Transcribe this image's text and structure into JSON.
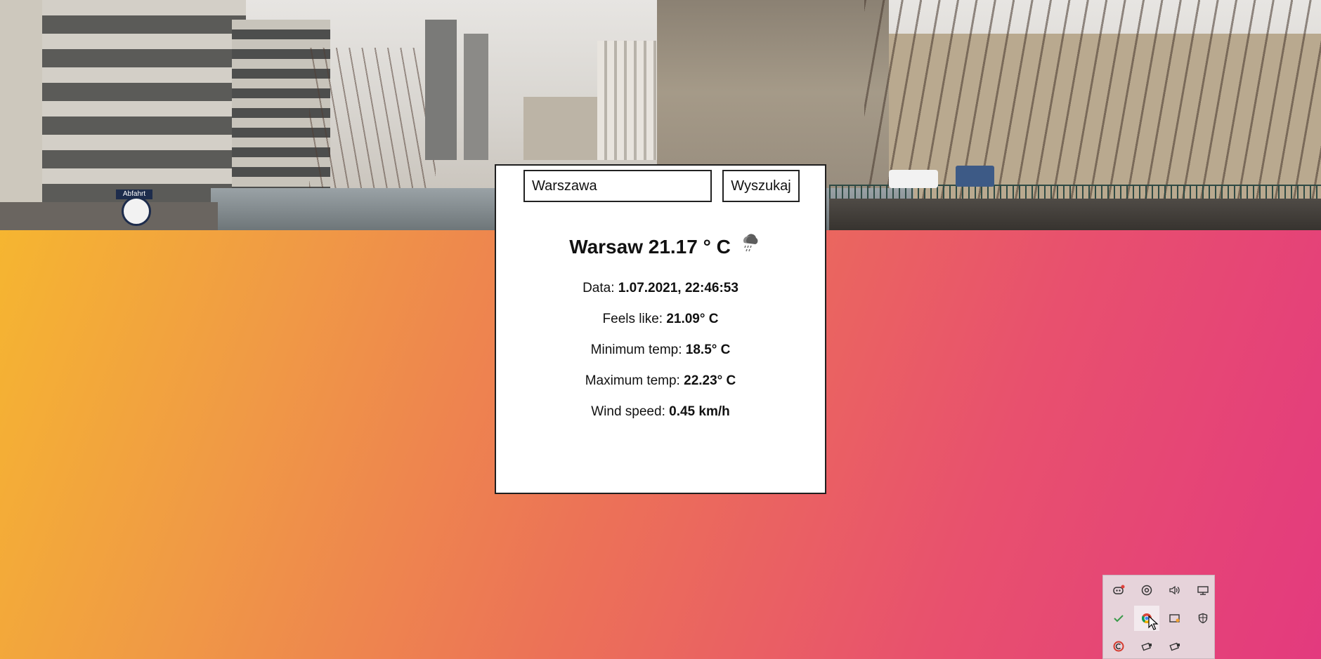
{
  "search": {
    "value": "Warszawa",
    "button_label": "Wyszukaj"
  },
  "weather": {
    "title": "Warsaw 21.17 ° C",
    "icon": "rain-cloud-icon",
    "date_label": "Data:",
    "date_value": "1.07.2021, 22:46:53",
    "feels_label": "Feels like:",
    "feels_value": "21.09° C",
    "min_label": "Minimum temp:",
    "min_value": "18.5° C",
    "max_label": "Maximum temp:",
    "max_value": "22.23° C",
    "wind_label": "Wind speed:",
    "wind_value": "0.45 km/h"
  },
  "background": {
    "clock_sign": "Abfahrt"
  },
  "tray": {
    "icons": [
      "discord-icon",
      "steam-icon",
      "volume-icon",
      "network-icon",
      "check-icon",
      "chrome-icon",
      "display-icon",
      "shield-icon",
      "ccleaner-icon",
      "usb-icon",
      "usb-icon"
    ]
  },
  "colors": {
    "gradient_start": "#f7bd2b",
    "gradient_end": "#e33a7e",
    "card_background": "#ffffff"
  }
}
